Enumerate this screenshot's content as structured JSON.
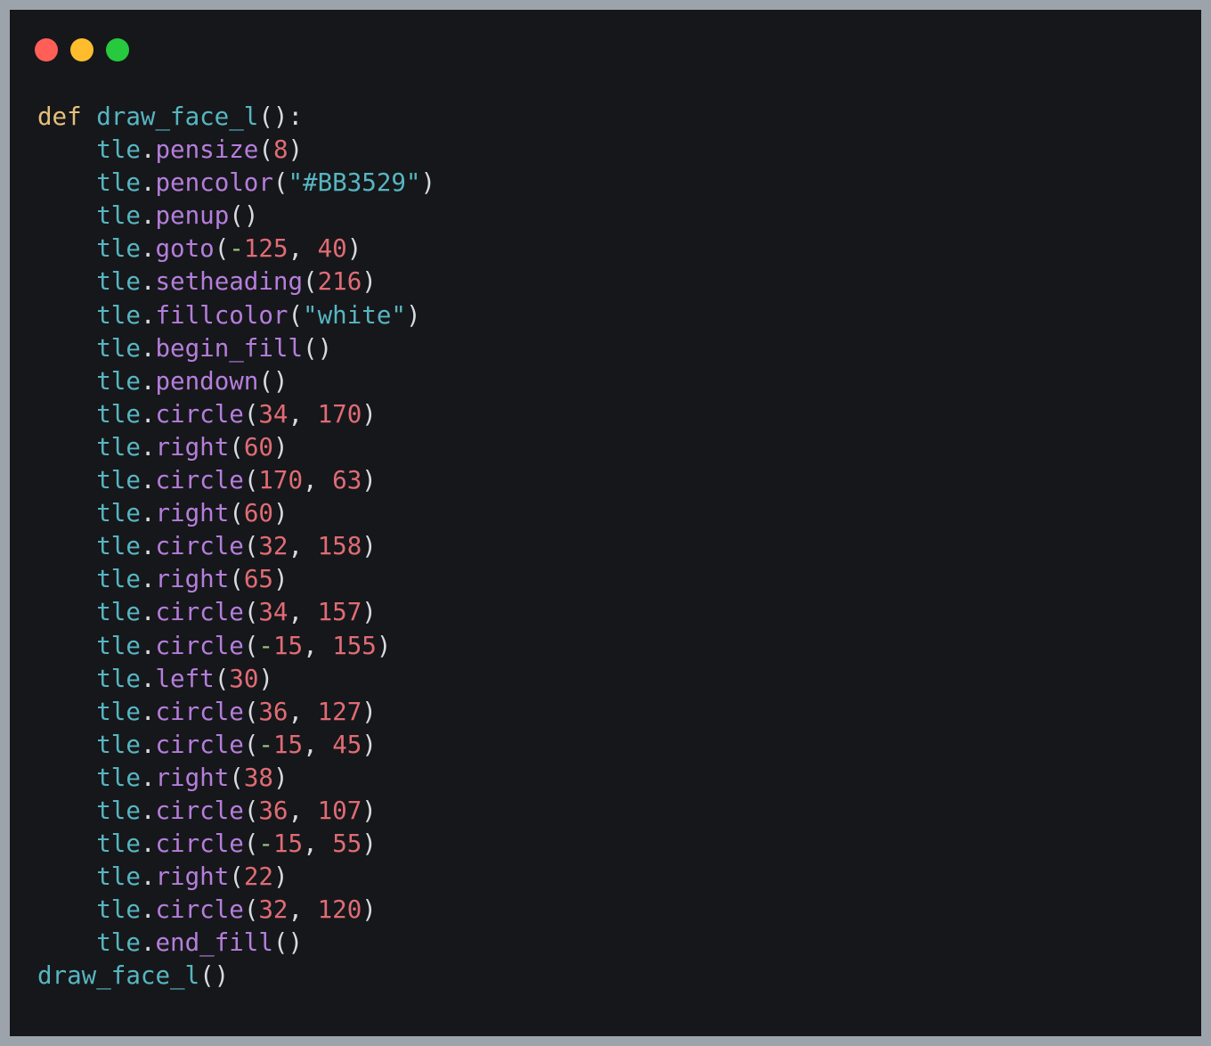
{
  "window": {
    "buttons": [
      {
        "name": "close-button",
        "color": "#ff5f56"
      },
      {
        "name": "minimize-button",
        "color": "#ffbd2e"
      },
      {
        "name": "maximize-button",
        "color": "#27c93f"
      }
    ]
  },
  "editor": {
    "language": "python",
    "lines": [
      [
        {
          "t": "kw",
          "v": "def"
        },
        {
          "t": "ws",
          "v": " "
        },
        {
          "t": "fn",
          "v": "draw_face_l"
        },
        {
          "t": "punct",
          "v": "():"
        }
      ],
      [
        {
          "t": "ws",
          "v": "    "
        },
        {
          "t": "obj",
          "v": "tle"
        },
        {
          "t": "punct",
          "v": "."
        },
        {
          "t": "method",
          "v": "pensize"
        },
        {
          "t": "punct",
          "v": "("
        },
        {
          "t": "num",
          "v": "8"
        },
        {
          "t": "punct",
          "v": ")"
        }
      ],
      [
        {
          "t": "ws",
          "v": "    "
        },
        {
          "t": "obj",
          "v": "tle"
        },
        {
          "t": "punct",
          "v": "."
        },
        {
          "t": "method",
          "v": "pencolor"
        },
        {
          "t": "punct",
          "v": "("
        },
        {
          "t": "str",
          "v": "\"#BB3529\""
        },
        {
          "t": "punct",
          "v": ")"
        }
      ],
      [
        {
          "t": "ws",
          "v": "    "
        },
        {
          "t": "obj",
          "v": "tle"
        },
        {
          "t": "punct",
          "v": "."
        },
        {
          "t": "method",
          "v": "penup"
        },
        {
          "t": "punct",
          "v": "()"
        }
      ],
      [
        {
          "t": "ws",
          "v": "    "
        },
        {
          "t": "obj",
          "v": "tle"
        },
        {
          "t": "punct",
          "v": "."
        },
        {
          "t": "method",
          "v": "goto"
        },
        {
          "t": "punct",
          "v": "("
        },
        {
          "t": "op",
          "v": "-"
        },
        {
          "t": "num",
          "v": "125"
        },
        {
          "t": "punct",
          "v": ", "
        },
        {
          "t": "num",
          "v": "40"
        },
        {
          "t": "punct",
          "v": ")"
        }
      ],
      [
        {
          "t": "ws",
          "v": "    "
        },
        {
          "t": "obj",
          "v": "tle"
        },
        {
          "t": "punct",
          "v": "."
        },
        {
          "t": "method",
          "v": "setheading"
        },
        {
          "t": "punct",
          "v": "("
        },
        {
          "t": "num",
          "v": "216"
        },
        {
          "t": "punct",
          "v": ")"
        }
      ],
      [
        {
          "t": "ws",
          "v": "    "
        },
        {
          "t": "obj",
          "v": "tle"
        },
        {
          "t": "punct",
          "v": "."
        },
        {
          "t": "method",
          "v": "fillcolor"
        },
        {
          "t": "punct",
          "v": "("
        },
        {
          "t": "str",
          "v": "\"white\""
        },
        {
          "t": "punct",
          "v": ")"
        }
      ],
      [
        {
          "t": "ws",
          "v": "    "
        },
        {
          "t": "obj",
          "v": "tle"
        },
        {
          "t": "punct",
          "v": "."
        },
        {
          "t": "method",
          "v": "begin_fill"
        },
        {
          "t": "punct",
          "v": "()"
        }
      ],
      [
        {
          "t": "ws",
          "v": "    "
        },
        {
          "t": "obj",
          "v": "tle"
        },
        {
          "t": "punct",
          "v": "."
        },
        {
          "t": "method",
          "v": "pendown"
        },
        {
          "t": "punct",
          "v": "()"
        }
      ],
      [
        {
          "t": "ws",
          "v": "    "
        },
        {
          "t": "obj",
          "v": "tle"
        },
        {
          "t": "punct",
          "v": "."
        },
        {
          "t": "method",
          "v": "circle"
        },
        {
          "t": "punct",
          "v": "("
        },
        {
          "t": "num",
          "v": "34"
        },
        {
          "t": "punct",
          "v": ", "
        },
        {
          "t": "num",
          "v": "170"
        },
        {
          "t": "punct",
          "v": ")"
        }
      ],
      [
        {
          "t": "ws",
          "v": "    "
        },
        {
          "t": "obj",
          "v": "tle"
        },
        {
          "t": "punct",
          "v": "."
        },
        {
          "t": "method",
          "v": "right"
        },
        {
          "t": "punct",
          "v": "("
        },
        {
          "t": "num",
          "v": "60"
        },
        {
          "t": "punct",
          "v": ")"
        }
      ],
      [
        {
          "t": "ws",
          "v": "    "
        },
        {
          "t": "obj",
          "v": "tle"
        },
        {
          "t": "punct",
          "v": "."
        },
        {
          "t": "method",
          "v": "circle"
        },
        {
          "t": "punct",
          "v": "("
        },
        {
          "t": "num",
          "v": "170"
        },
        {
          "t": "punct",
          "v": ", "
        },
        {
          "t": "num",
          "v": "63"
        },
        {
          "t": "punct",
          "v": ")"
        }
      ],
      [
        {
          "t": "ws",
          "v": "    "
        },
        {
          "t": "obj",
          "v": "tle"
        },
        {
          "t": "punct",
          "v": "."
        },
        {
          "t": "method",
          "v": "right"
        },
        {
          "t": "punct",
          "v": "("
        },
        {
          "t": "num",
          "v": "60"
        },
        {
          "t": "punct",
          "v": ")"
        }
      ],
      [
        {
          "t": "ws",
          "v": "    "
        },
        {
          "t": "obj",
          "v": "tle"
        },
        {
          "t": "punct",
          "v": "."
        },
        {
          "t": "method",
          "v": "circle"
        },
        {
          "t": "punct",
          "v": "("
        },
        {
          "t": "num",
          "v": "32"
        },
        {
          "t": "punct",
          "v": ", "
        },
        {
          "t": "num",
          "v": "158"
        },
        {
          "t": "punct",
          "v": ")"
        }
      ],
      [
        {
          "t": "ws",
          "v": "    "
        },
        {
          "t": "obj",
          "v": "tle"
        },
        {
          "t": "punct",
          "v": "."
        },
        {
          "t": "method",
          "v": "right"
        },
        {
          "t": "punct",
          "v": "("
        },
        {
          "t": "num",
          "v": "65"
        },
        {
          "t": "punct",
          "v": ")"
        }
      ],
      [
        {
          "t": "ws",
          "v": "    "
        },
        {
          "t": "obj",
          "v": "tle"
        },
        {
          "t": "punct",
          "v": "."
        },
        {
          "t": "method",
          "v": "circle"
        },
        {
          "t": "punct",
          "v": "("
        },
        {
          "t": "num",
          "v": "34"
        },
        {
          "t": "punct",
          "v": ", "
        },
        {
          "t": "num",
          "v": "157"
        },
        {
          "t": "punct",
          "v": ")"
        }
      ],
      [
        {
          "t": "ws",
          "v": "    "
        },
        {
          "t": "obj",
          "v": "tle"
        },
        {
          "t": "punct",
          "v": "."
        },
        {
          "t": "method",
          "v": "circle"
        },
        {
          "t": "punct",
          "v": "("
        },
        {
          "t": "op",
          "v": "-"
        },
        {
          "t": "num",
          "v": "15"
        },
        {
          "t": "punct",
          "v": ", "
        },
        {
          "t": "num",
          "v": "155"
        },
        {
          "t": "punct",
          "v": ")"
        }
      ],
      [
        {
          "t": "ws",
          "v": "    "
        },
        {
          "t": "obj",
          "v": "tle"
        },
        {
          "t": "punct",
          "v": "."
        },
        {
          "t": "method",
          "v": "left"
        },
        {
          "t": "punct",
          "v": "("
        },
        {
          "t": "num",
          "v": "30"
        },
        {
          "t": "punct",
          "v": ")"
        }
      ],
      [
        {
          "t": "ws",
          "v": "    "
        },
        {
          "t": "obj",
          "v": "tle"
        },
        {
          "t": "punct",
          "v": "."
        },
        {
          "t": "method",
          "v": "circle"
        },
        {
          "t": "punct",
          "v": "("
        },
        {
          "t": "num",
          "v": "36"
        },
        {
          "t": "punct",
          "v": ", "
        },
        {
          "t": "num",
          "v": "127"
        },
        {
          "t": "punct",
          "v": ")"
        }
      ],
      [
        {
          "t": "ws",
          "v": "    "
        },
        {
          "t": "obj",
          "v": "tle"
        },
        {
          "t": "punct",
          "v": "."
        },
        {
          "t": "method",
          "v": "circle"
        },
        {
          "t": "punct",
          "v": "("
        },
        {
          "t": "op",
          "v": "-"
        },
        {
          "t": "num",
          "v": "15"
        },
        {
          "t": "punct",
          "v": ", "
        },
        {
          "t": "num",
          "v": "45"
        },
        {
          "t": "punct",
          "v": ")"
        }
      ],
      [
        {
          "t": "ws",
          "v": "    "
        },
        {
          "t": "obj",
          "v": "tle"
        },
        {
          "t": "punct",
          "v": "."
        },
        {
          "t": "method",
          "v": "right"
        },
        {
          "t": "punct",
          "v": "("
        },
        {
          "t": "num",
          "v": "38"
        },
        {
          "t": "punct",
          "v": ")"
        }
      ],
      [
        {
          "t": "ws",
          "v": "    "
        },
        {
          "t": "obj",
          "v": "tle"
        },
        {
          "t": "punct",
          "v": "."
        },
        {
          "t": "method",
          "v": "circle"
        },
        {
          "t": "punct",
          "v": "("
        },
        {
          "t": "num",
          "v": "36"
        },
        {
          "t": "punct",
          "v": ", "
        },
        {
          "t": "num",
          "v": "107"
        },
        {
          "t": "punct",
          "v": ")"
        }
      ],
      [
        {
          "t": "ws",
          "v": "    "
        },
        {
          "t": "obj",
          "v": "tle"
        },
        {
          "t": "punct",
          "v": "."
        },
        {
          "t": "method",
          "v": "circle"
        },
        {
          "t": "punct",
          "v": "("
        },
        {
          "t": "op",
          "v": "-"
        },
        {
          "t": "num",
          "v": "15"
        },
        {
          "t": "punct",
          "v": ", "
        },
        {
          "t": "num",
          "v": "55"
        },
        {
          "t": "punct",
          "v": ")"
        }
      ],
      [
        {
          "t": "ws",
          "v": "    "
        },
        {
          "t": "obj",
          "v": "tle"
        },
        {
          "t": "punct",
          "v": "."
        },
        {
          "t": "method",
          "v": "right"
        },
        {
          "t": "punct",
          "v": "("
        },
        {
          "t": "num",
          "v": "22"
        },
        {
          "t": "punct",
          "v": ")"
        }
      ],
      [
        {
          "t": "ws",
          "v": "    "
        },
        {
          "t": "obj",
          "v": "tle"
        },
        {
          "t": "punct",
          "v": "."
        },
        {
          "t": "method",
          "v": "circle"
        },
        {
          "t": "punct",
          "v": "("
        },
        {
          "t": "num",
          "v": "32"
        },
        {
          "t": "punct",
          "v": ", "
        },
        {
          "t": "num",
          "v": "120"
        },
        {
          "t": "punct",
          "v": ")"
        }
      ],
      [
        {
          "t": "ws",
          "v": "    "
        },
        {
          "t": "obj",
          "v": "tle"
        },
        {
          "t": "punct",
          "v": "."
        },
        {
          "t": "method",
          "v": "end_fill"
        },
        {
          "t": "punct",
          "v": "()"
        }
      ],
      [
        {
          "t": "fn",
          "v": "draw_face_l"
        },
        {
          "t": "punct",
          "v": "()"
        }
      ]
    ]
  }
}
